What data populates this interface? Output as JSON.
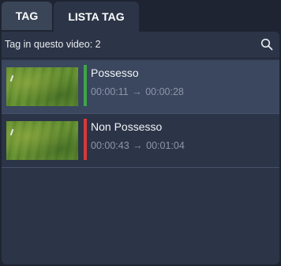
{
  "tabs": [
    {
      "label": "TAG",
      "active": false
    },
    {
      "label": "LISTA TAG",
      "active": true
    }
  ],
  "search": {
    "count_label": "Tag in questo video: 2",
    "icon": "search-icon"
  },
  "tags": [
    {
      "title": "Possesso",
      "start": "00:00:11",
      "arrow": "→",
      "end": "00:00:28",
      "color": "#3fa548",
      "selected": true
    },
    {
      "title": "Non Possesso",
      "start": "00:00:43",
      "arrow": "→",
      "end": "00:01:04",
      "color": "#d9383a",
      "selected": false
    }
  ],
  "colors": {
    "background": "#1e2431",
    "panel": "#2c3547",
    "selected_row": "#3a475e"
  }
}
